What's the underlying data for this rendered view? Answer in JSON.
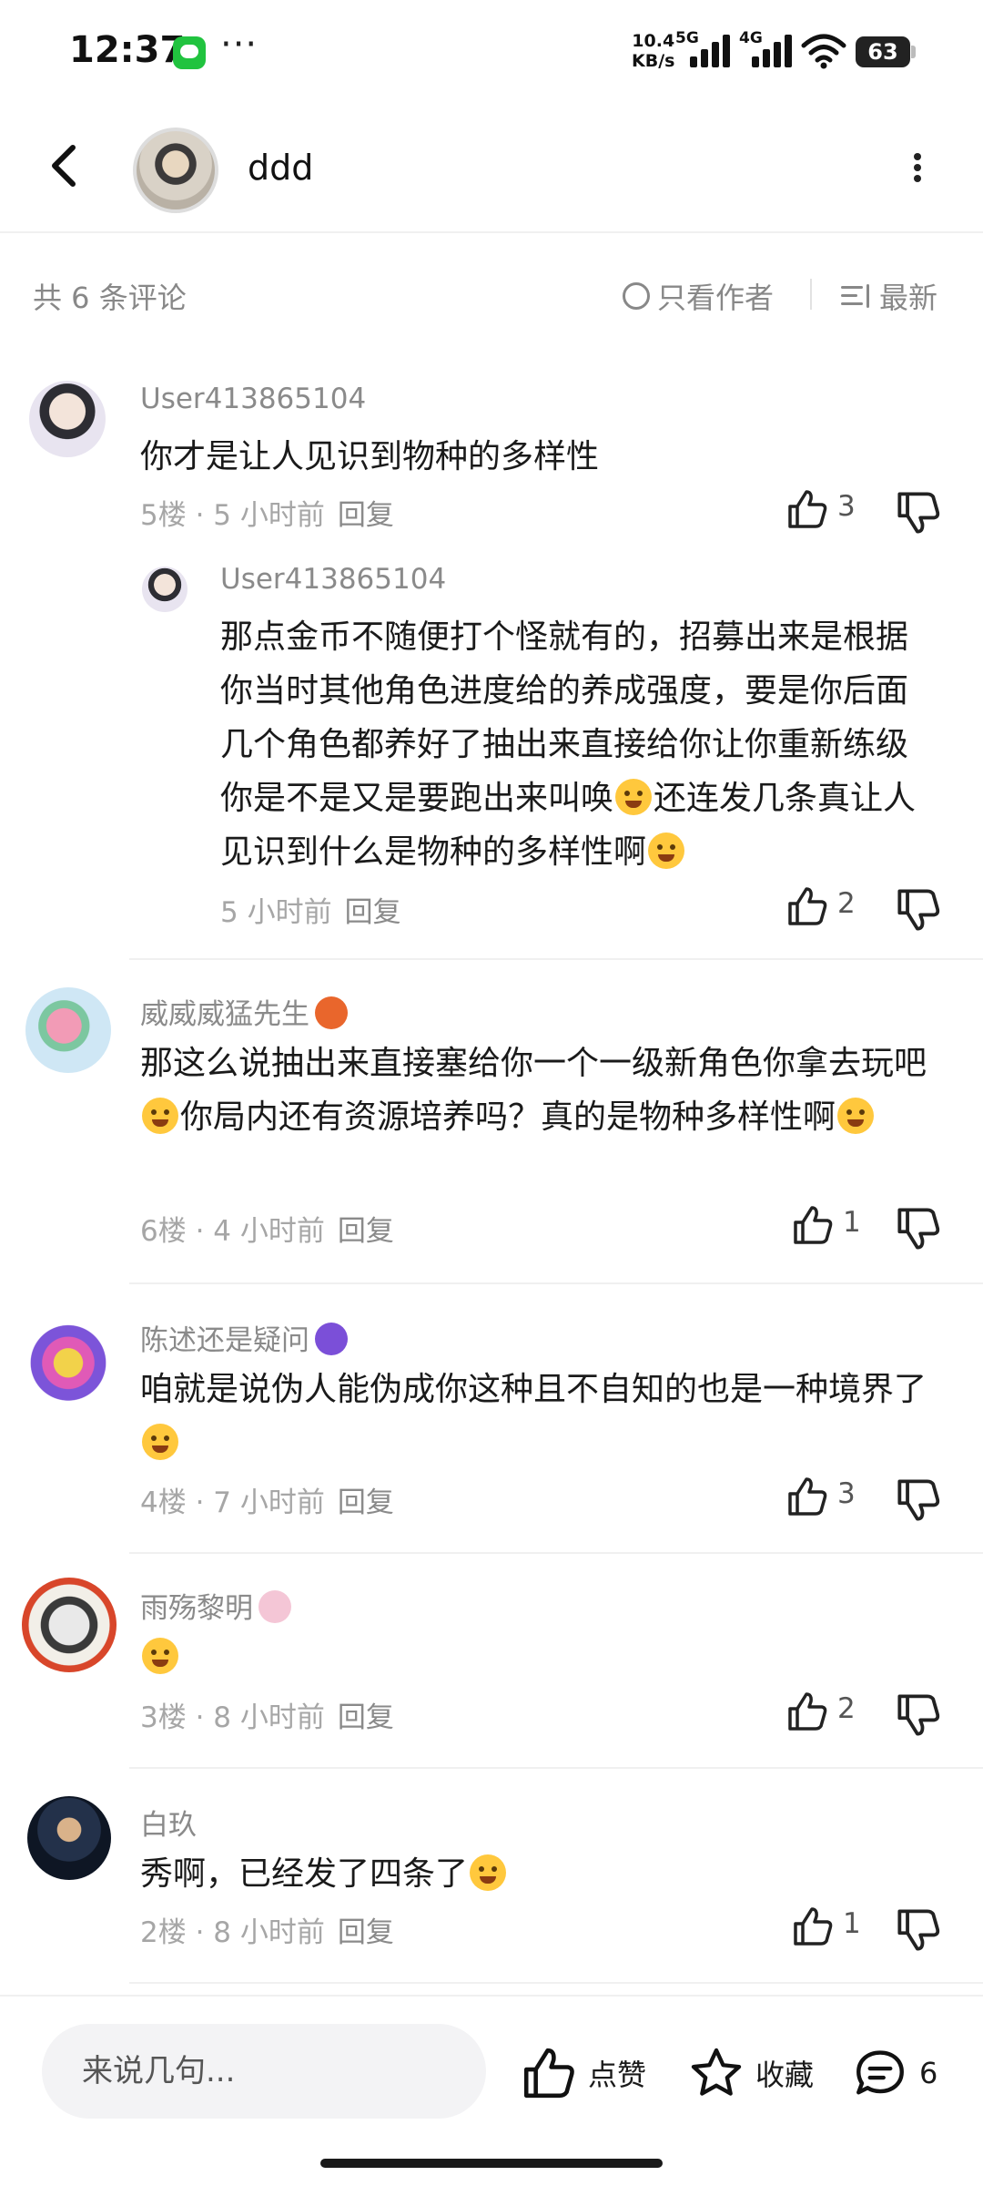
{
  "status_bar": {
    "time": "12:37",
    "dots": "···",
    "speed_top": "10.4",
    "speed_bottom": "KB/s",
    "sig1_label": "5G",
    "sig2_label": "4G",
    "battery": "63"
  },
  "header": {
    "title": "ddd"
  },
  "toolbar": {
    "count": "共 6 条评论",
    "author_only": "只看作者",
    "sort": "最新"
  },
  "comments": [
    {
      "user": "User413865104",
      "text": "你才是让人见识到物种的多样性",
      "meta": "5楼 · 5 小时前",
      "reply": "回复",
      "likes": "3"
    },
    {
      "user": "User413865104",
      "text_a": "那点金币不随便打个怪就有的，招募出来是根据你当时其他角色进度给的养成强度，要是你后面几个角色都养好了抽出来直接给你让你重新练级你是不是又是要跑出来叫唤",
      "text_b": "还连发几条真让人见识到什么是物种的多样性啊",
      "meta": "5 小时前",
      "reply": "回复",
      "likes": "2"
    },
    {
      "user": "威威威猛先生",
      "text_a": "那这么说抽出来直接塞给你一个一级新角色你拿去玩吧",
      "text_b": "你局内还有资源培养吗？真的是物种多样性啊",
      "meta": "6楼 · 4 小时前",
      "reply": "回复",
      "likes": "1"
    },
    {
      "user": "陈述还是疑问",
      "text": "咱就是说伪人能伪成你这种且不自知的也是一种境界了",
      "meta": "4楼 · 7 小时前",
      "reply": "回复",
      "likes": "3"
    },
    {
      "user": "雨殇黎明",
      "meta": "3楼 · 8 小时前",
      "reply": "回复",
      "likes": "2"
    },
    {
      "user": "白玖",
      "text": "秀啊，已经发了四条了",
      "meta": "2楼 · 8 小时前",
      "reply": "回复",
      "likes": "1"
    }
  ],
  "bottom_bar": {
    "placeholder": "来说几句...",
    "like_label": "点赞",
    "fav_label": "收藏",
    "comment_count": "6"
  },
  "colors": {
    "muted": "#8a8a8a",
    "text": "#1a1a1a",
    "input_bg": "#f3f3f5"
  }
}
